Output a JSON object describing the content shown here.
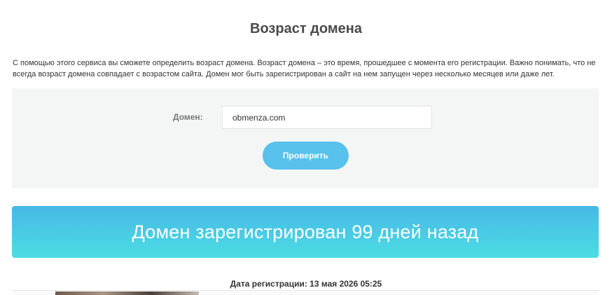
{
  "page": {
    "title": "Возраст домена",
    "description": "С помощью этого сервиса вы сможете определить возраст домена. Возраст домена – это время, прошедшее с момента его регистрации. Важно понимать, что не всегда возраст домена совпадает с возрастом сайта. Домен мог быть зарегистрирован а сайт на нем запущен через несколько месяцев или даже лет."
  },
  "form": {
    "domain_label": "Домен:",
    "domain_value": "obmenza.com",
    "check_button_label": "Проверить"
  },
  "result": {
    "message": "Домен зарегистрирован 99 дней назад",
    "registration_date": "Дата регистрации: 13 мая 2026 05:25"
  },
  "colors": {
    "button": "#58c1ec",
    "banner_top": "#47b8e6",
    "banner_bottom": "#4cdde3"
  }
}
